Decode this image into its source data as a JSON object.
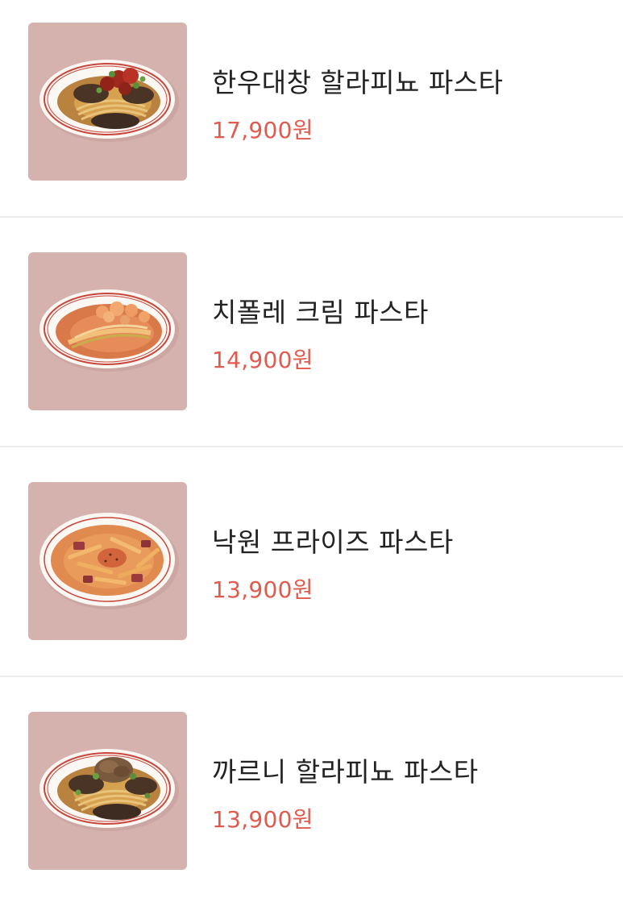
{
  "colors": {
    "thumb_bg": "#d6b2af",
    "price": "#e05a4e",
    "name": "#222222",
    "divider": "#ececec"
  },
  "menu": {
    "items": [
      {
        "name": "한우대창 할라피뇨 파스타",
        "price": "17,900원",
        "image_icon": "pasta-beef-tripe-jalapeno-icon"
      },
      {
        "name": "치폴레 크림 파스타",
        "price": "14,900원",
        "image_icon": "pasta-chipotle-cream-icon"
      },
      {
        "name": "낙원 프라이즈 파스타",
        "price": "13,900원",
        "image_icon": "pasta-fries-icon"
      },
      {
        "name": "까르니 할라피뇨 파스타",
        "price": "13,900원",
        "image_icon": "pasta-carni-jalapeno-icon"
      }
    ]
  }
}
